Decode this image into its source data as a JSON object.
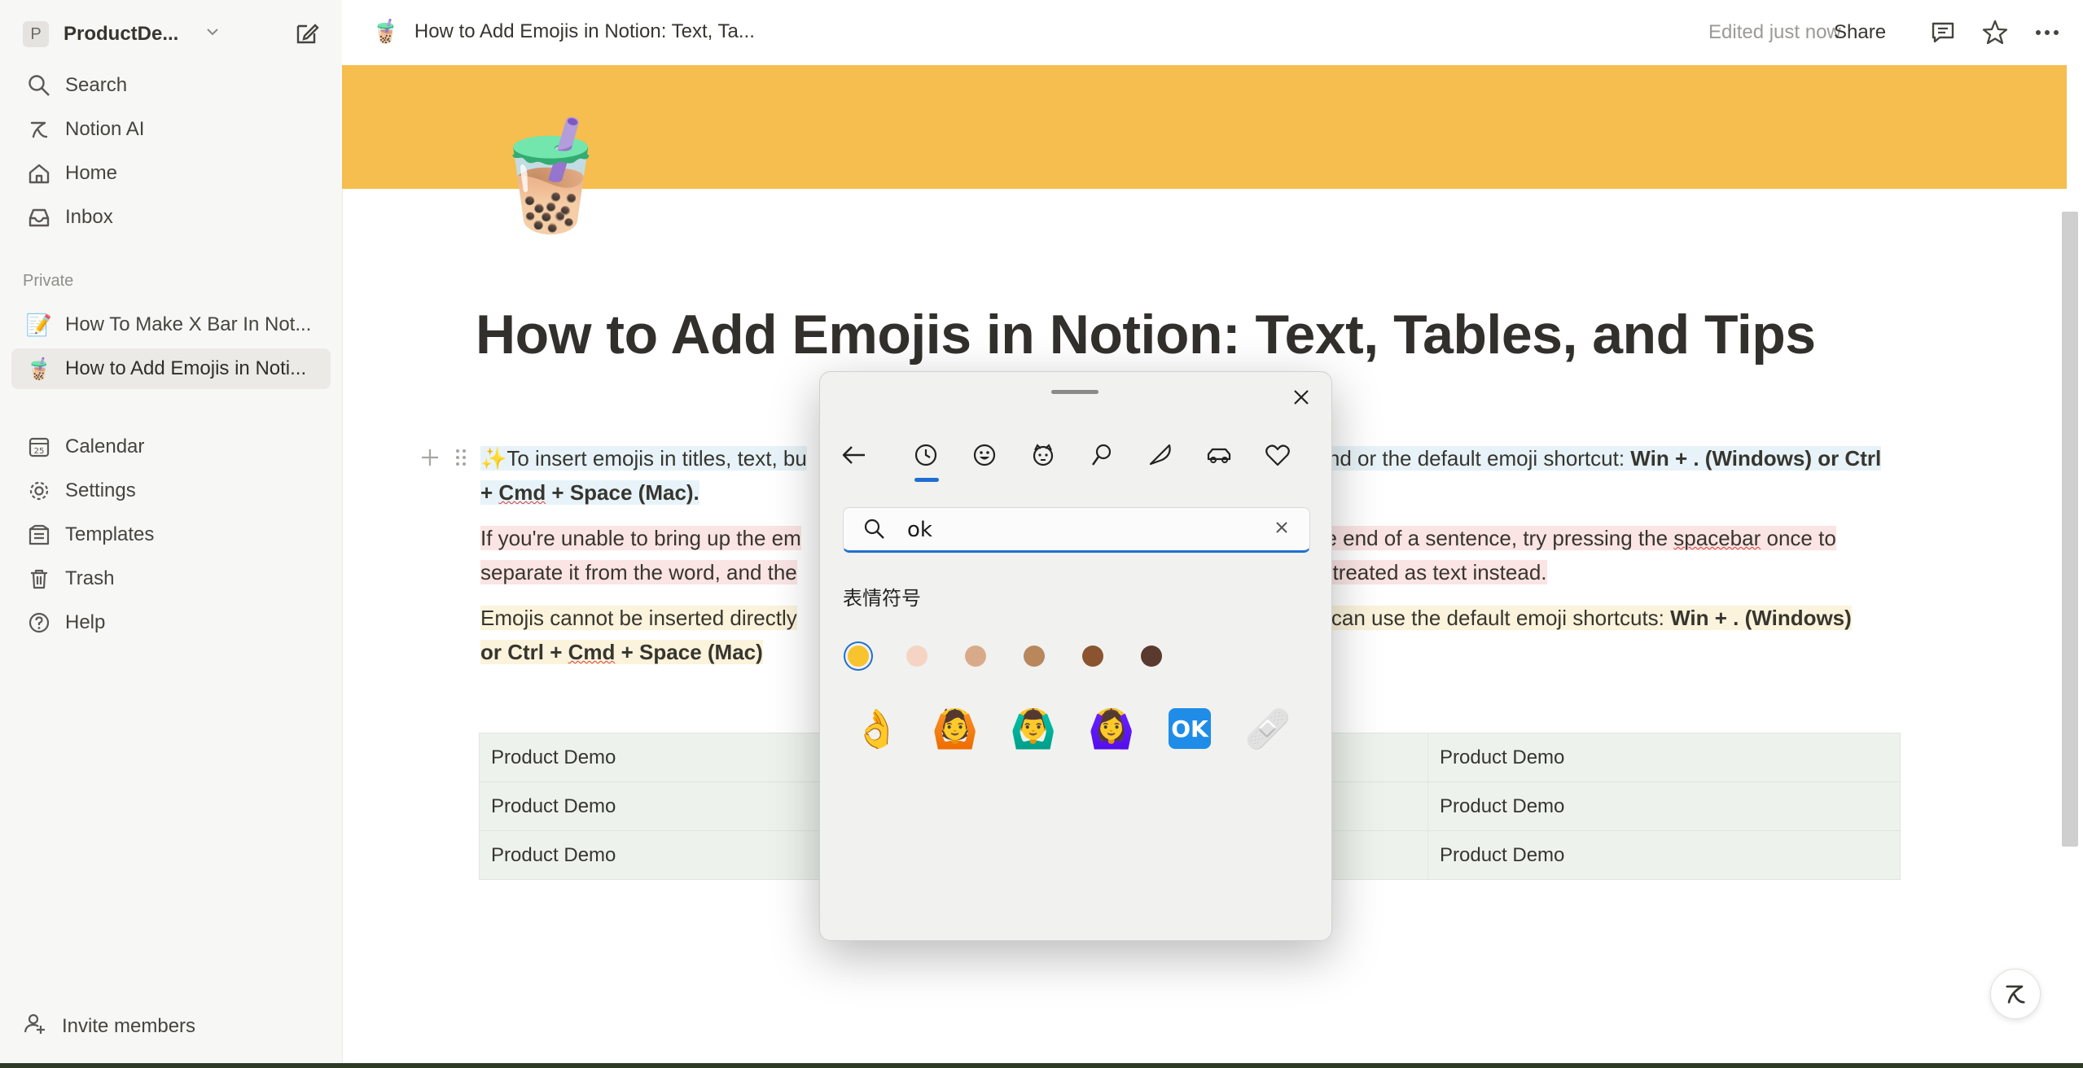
{
  "sidebar": {
    "workspace_initial": "P",
    "workspace_name": "ProductDe...",
    "nav": [
      {
        "label": "Search",
        "icon": "search-icon"
      },
      {
        "label": "Notion AI",
        "icon": "notion-ai-icon"
      },
      {
        "label": "Home",
        "icon": "home-icon"
      },
      {
        "label": "Inbox",
        "icon": "inbox-icon"
      }
    ],
    "section_label": "Private",
    "pages": [
      {
        "label": "How To Make X Bar In Not...",
        "emoji": "📝"
      },
      {
        "label": "How to Add Emojis in Noti...",
        "emoji": "🧋"
      }
    ],
    "tools": [
      {
        "label": "Calendar",
        "icon": "calendar-icon",
        "badge": "25"
      },
      {
        "label": "Settings",
        "icon": "gear-icon"
      },
      {
        "label": "Templates",
        "icon": "templates-icon"
      },
      {
        "label": "Trash",
        "icon": "trash-icon"
      },
      {
        "label": "Help",
        "icon": "help-icon"
      }
    ],
    "invite_label": "Invite members"
  },
  "topbar": {
    "breadcrumb_emoji": "🧋",
    "breadcrumb": "How to Add Emojis in Notion: Text, Ta...",
    "edited": "Edited just now",
    "share": "Share"
  },
  "page": {
    "cover_color": "#f6bd4f",
    "icon": "🧋",
    "title": "How to Add Emojis in Notion: Text, Tables, and Tips",
    "p1": {
      "emoji": "✨",
      "t1": "To insert emojis in titles, text, bu",
      "t2": "nd or the default emoji shortcut: ",
      "b1": "Win + . (Windows) or Ctrl",
      "b2": "+ ",
      "b3": "Cmd",
      "b4": " + Space (Mac)."
    },
    "p2": {
      "t1": "If you're unable to bring up the em",
      "t2": "the end of a sentence, try pressing the ",
      "t3": "spacebar",
      "t4": " once to",
      "t5": "separate it from the word, and the",
      "t6": "n treated as text instead."
    },
    "p3": {
      "t1": "Emojis cannot be inserted directly",
      "t2": "ou can use the default emoji shortcuts: ",
      "b1": "Win + . (Windows)",
      "b2": "or Ctrl + ",
      "b3": "Cmd",
      "b4": " + Space (Mac)"
    },
    "table_rows": [
      [
        "Product Demo",
        "Product Demo"
      ],
      [
        "Product Demo",
        "Product Demo"
      ],
      [
        "Product Demo",
        "Product Demo"
      ]
    ]
  },
  "emoji_picker": {
    "categories": [
      "back-arrow-icon",
      "recent-icon",
      "smiley-icon",
      "kaomoji-icon",
      "symbols-icon",
      "food-icon",
      "car-icon",
      "heart-icon"
    ],
    "search_value": "ok",
    "heading": "表情符号",
    "skin_tones": [
      "#f7c32e",
      "#f6d4c4",
      "#d9aa8a",
      "#b8875c",
      "#8a5430",
      "#5a3a2e"
    ],
    "selected_tone_index": 0,
    "results": [
      "👌",
      "🙆",
      "🙆‍♂️",
      "🙆‍♀️",
      "OK",
      "🩹"
    ]
  }
}
